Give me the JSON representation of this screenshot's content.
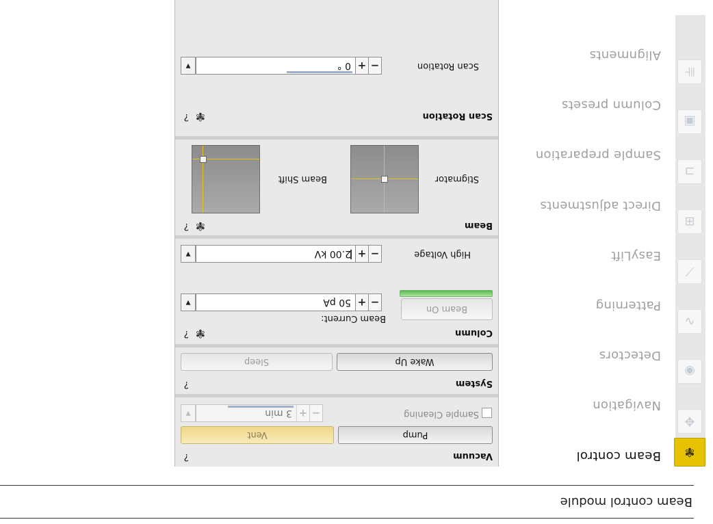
{
  "caption": "Beam control module",
  "modules": {
    "items": [
      {
        "label": "Beam control",
        "icon": "atom-icon",
        "active": true
      },
      {
        "label": "Navigation",
        "icon": "navigation-icon",
        "active": false
      },
      {
        "label": "Detectors",
        "icon": "eye-icon",
        "active": false
      },
      {
        "label": "Patterning",
        "icon": "wave-icon",
        "active": false
      },
      {
        "label": "EasyLift",
        "icon": "needle-icon",
        "active": false
      },
      {
        "label": "Direct adjustments",
        "icon": "adjust-icon",
        "active": false
      },
      {
        "label": "Sample preparation",
        "icon": "hierarchy-icon",
        "active": false
      },
      {
        "label": "Column presets",
        "icon": "presets-icon",
        "active": false
      },
      {
        "label": "Alignments",
        "icon": "sliders-icon",
        "active": false
      }
    ]
  },
  "panel": {
    "help_symbol": "?",
    "vacuum": {
      "title": "Vacuum",
      "pump_label": "Pump",
      "vent_label": "Vent",
      "cleaning_label": "Sample Cleaning",
      "cleaning_checked": false,
      "cleaning_value": "3 min"
    },
    "system": {
      "title": "System",
      "wake_label": "Wake Up",
      "sleep_label": "Sleep"
    },
    "column": {
      "title": "Column",
      "beam_on_label": "Beam On",
      "current_label": "Beam Current:",
      "current_value": "50 pA",
      "hv_label": "High Voltage",
      "hv_value": "2.00 kV"
    },
    "beam": {
      "title": "Beam",
      "stigmator_label": "Stigmator",
      "shift_label": "Beam Shift"
    },
    "scan": {
      "title": "Scan Rotation",
      "rotation_label": "Scan Rotation",
      "rotation_value": "0 °"
    }
  },
  "colors": {
    "active_module": "#e6c200",
    "crosshair": "#e2c21c",
    "beam_led": "#57b94e",
    "vent_button": "#efd78a"
  }
}
